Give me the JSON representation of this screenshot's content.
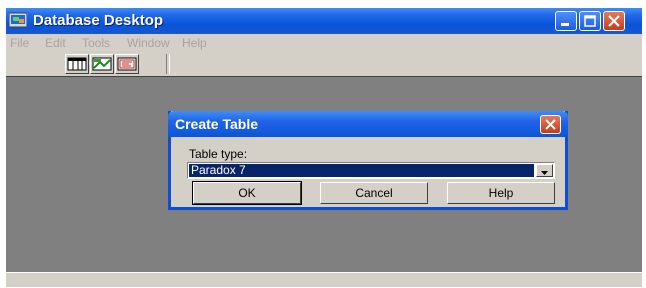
{
  "window": {
    "title": "Database Desktop",
    "menu": [
      "File",
      "Edit",
      "Tools",
      "Window",
      "Help"
    ]
  },
  "toolbar": {
    "buttons": [
      {
        "icon": "table-icon"
      },
      {
        "icon": "query-icon"
      },
      {
        "icon": "sql-icon"
      }
    ]
  },
  "dialog": {
    "title": "Create Table",
    "table_type_label": "Table type:",
    "table_type_value": "Paradox 7",
    "ok_label": "OK",
    "cancel_label": "Cancel",
    "help_label": "Help"
  },
  "colors": {
    "titlebar": "#0a53d8",
    "workspace": "#808080",
    "dialog_face": "#d4d0c8",
    "selection": "#0a246a",
    "close_button": "#c43c1b"
  }
}
